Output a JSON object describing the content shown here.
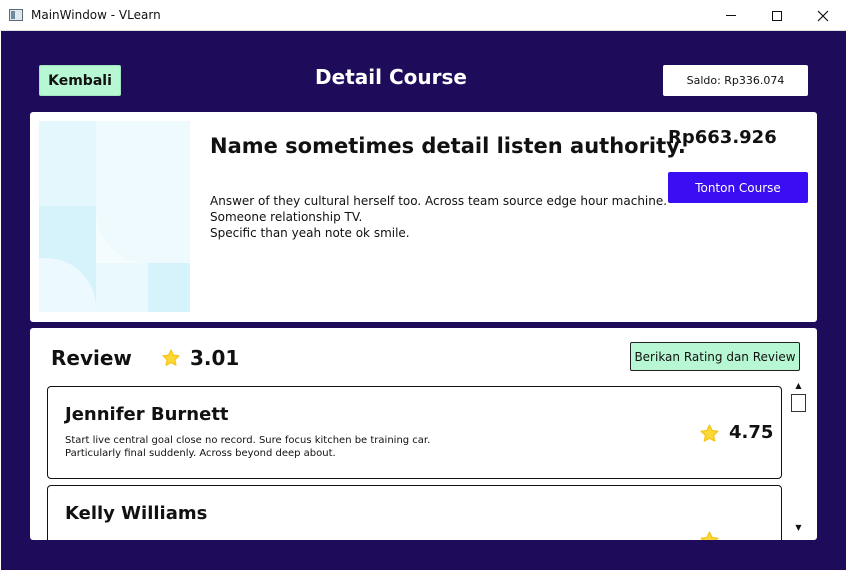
{
  "window": {
    "title": "MainWindow - VLearn",
    "controls": [
      "minimize",
      "maximize",
      "close"
    ]
  },
  "header": {
    "back_label": "Kembali",
    "title": "Detail Course",
    "saldo": "Saldo: Rp336.074"
  },
  "course": {
    "title": "Name sometimes detail listen authority.",
    "description_lines": [
      "Answer of they cultural herself too. Across team source edge hour machine.",
      "Someone relationship TV.",
      "Specific than yeah note ok smile."
    ],
    "price": "Rp663.926",
    "watch_label": "Tonton Course"
  },
  "review": {
    "heading": "Review",
    "average": "3.01",
    "rate_button": "Berikan Rating dan Review",
    "items": [
      {
        "name": "Jennifer Burnett",
        "text_lines": [
          "Start live central goal close no record. Sure focus kitchen be training car.",
          "Particularly final suddenly. Across beyond deep about."
        ],
        "rating": "4.75"
      },
      {
        "name": "Kelly Williams",
        "text_lines": [],
        "rating": ""
      }
    ]
  },
  "colors": {
    "background": "#1e0b5a",
    "accent_green": "#b8f7d4",
    "primary_button": "#3b0df2",
    "star": "#fdd835"
  },
  "icons": {
    "star": "star-icon",
    "scroll_up": "arrow-up-icon",
    "scroll_down": "arrow-down-icon"
  }
}
